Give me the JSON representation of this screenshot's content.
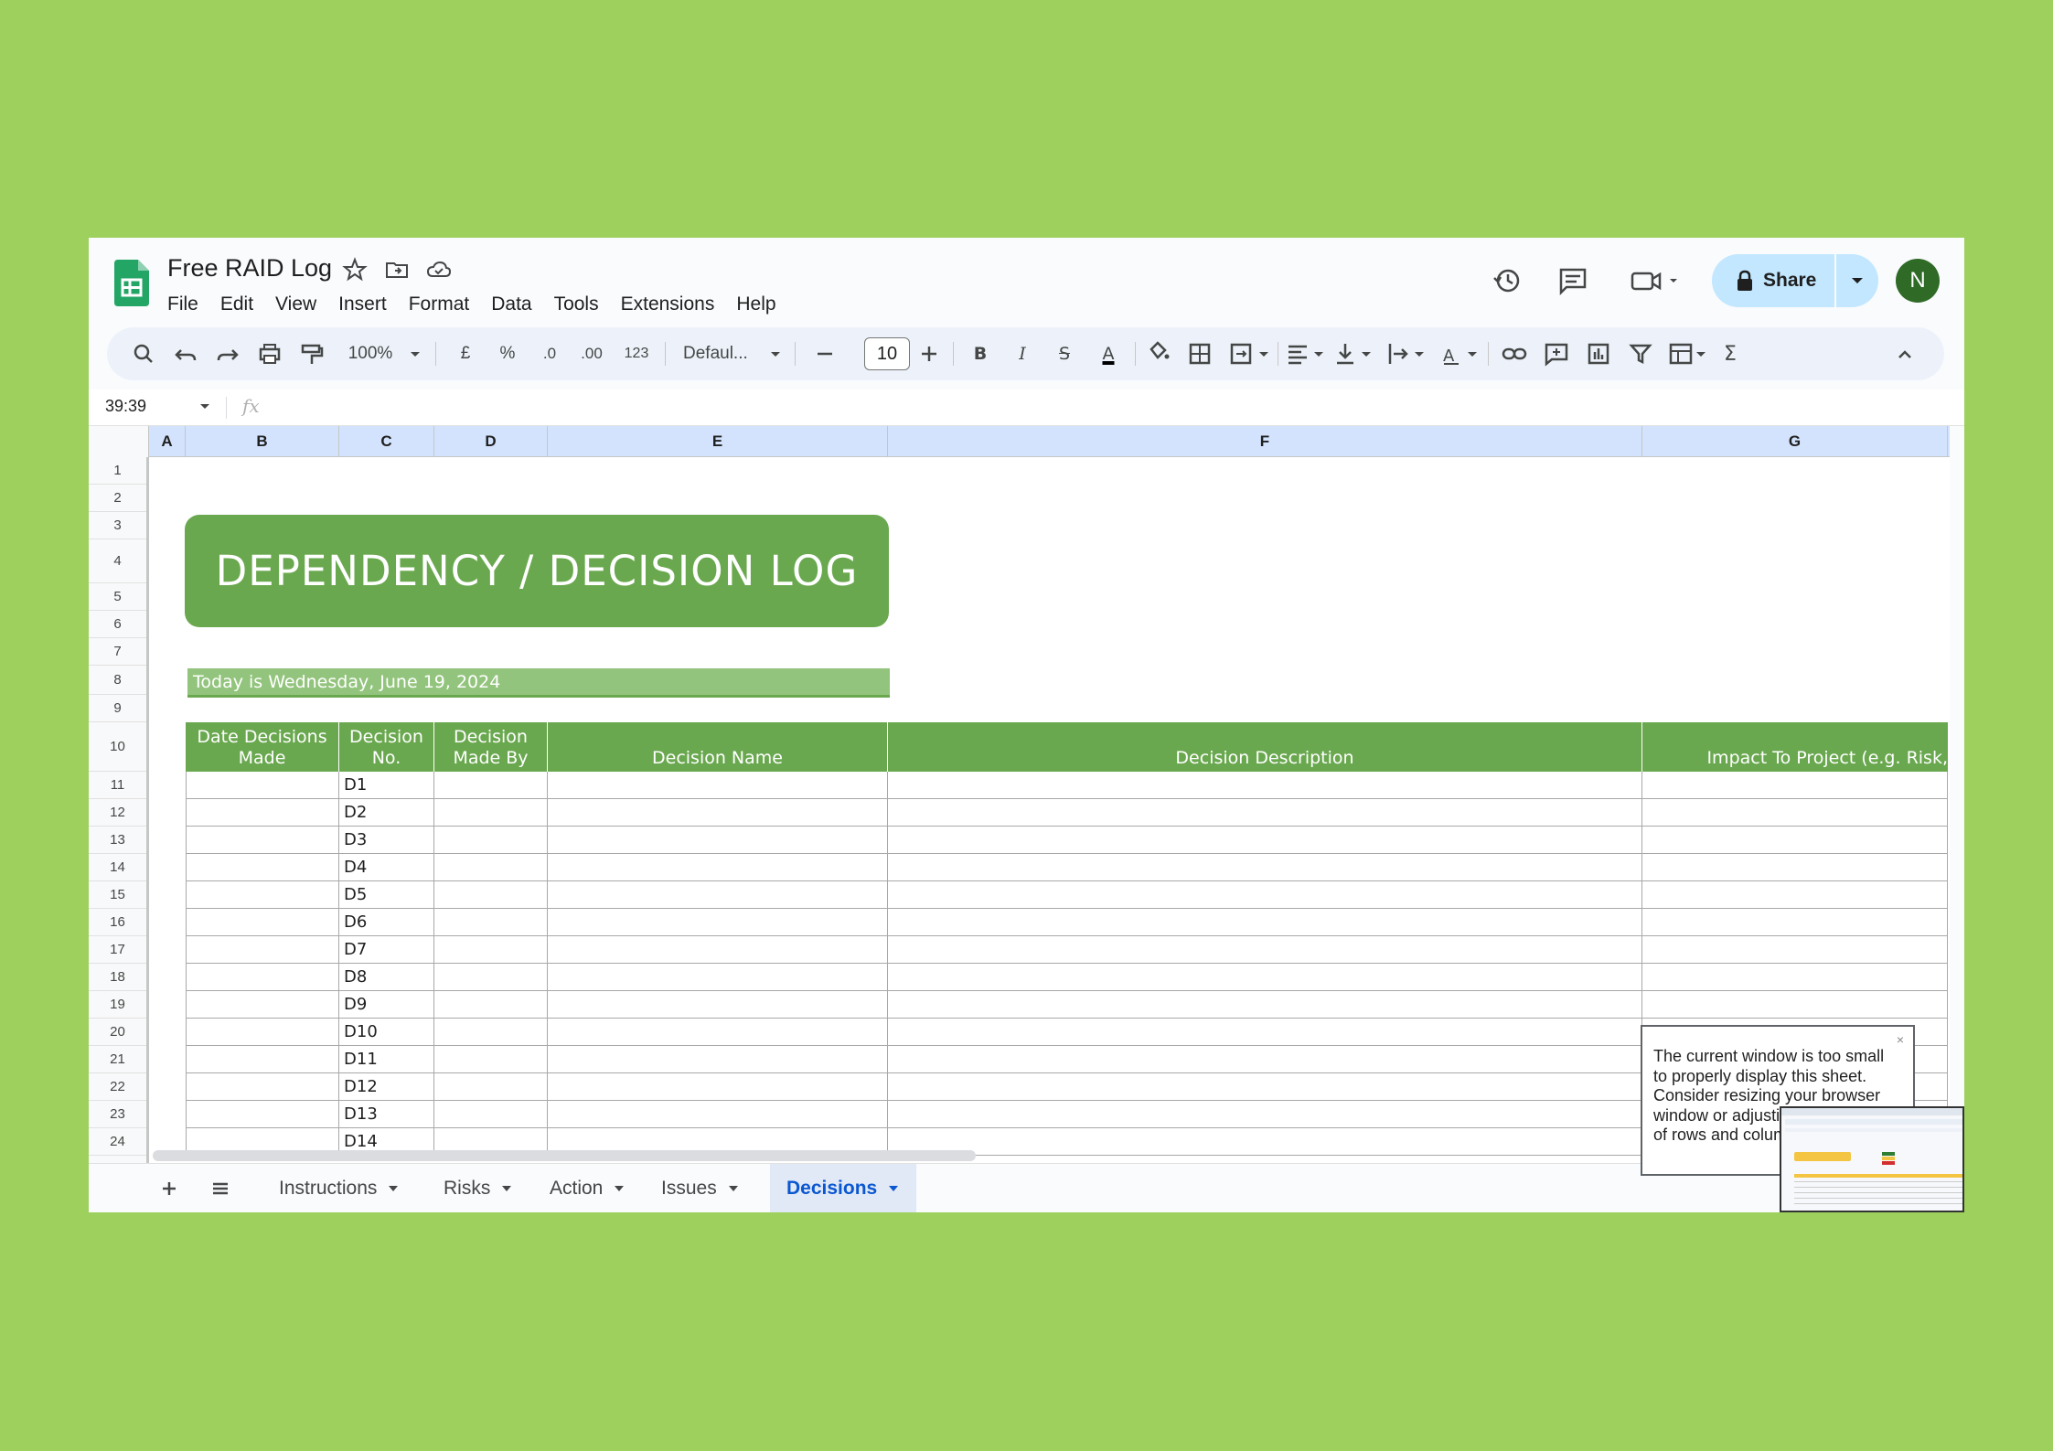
{
  "app": {
    "title": "Free RAID Log"
  },
  "menu": [
    "File",
    "Edit",
    "View",
    "Insert",
    "Format",
    "Data",
    "Tools",
    "Extensions",
    "Help"
  ],
  "share": {
    "label": "Share",
    "avatar": "N"
  },
  "toolbar": {
    "zoom": "100%",
    "currency": "£",
    "percent": "%",
    "decrease_decimal": ".0",
    "increase_decimal": ".00",
    "number_format": "123",
    "font": "Defaul...",
    "font_size": "10",
    "bold": "B",
    "italic": "I",
    "strike": "S",
    "text_color": "A"
  },
  "formula_bar": {
    "cell_ref": "39:39",
    "fx": "fx"
  },
  "columns": [
    "A",
    "B",
    "C",
    "D",
    "E",
    "F",
    "G"
  ],
  "rows": [
    "1",
    "2",
    "3",
    "4",
    "5",
    "6",
    "7",
    "8",
    "9",
    "10",
    "11",
    "12",
    "13",
    "14",
    "15",
    "16",
    "17",
    "18",
    "19",
    "20",
    "21",
    "22",
    "23",
    "24"
  ],
  "sheet": {
    "banner": "DEPENDENCY / DECISION LOG",
    "today": "Today is Wednesday, June 19, 2024",
    "headers": [
      "Date Decisions\nMade",
      "Decision\nNo.",
      "Decision\nMade By",
      "Decision Name",
      "Decision Description",
      "Impact To Project (e.g. Risk,"
    ],
    "decision_numbers": [
      "D1",
      "D2",
      "D3",
      "D4",
      "D5",
      "D6",
      "D7",
      "D8",
      "D9",
      "D10",
      "D11",
      "D12",
      "D13",
      "D14"
    ]
  },
  "tabs": [
    {
      "label": "Instructions",
      "active": false
    },
    {
      "label": "Risks",
      "active": false
    },
    {
      "label": "Action",
      "active": false
    },
    {
      "label": "Issues",
      "active": false
    },
    {
      "label": "Decisions",
      "active": true
    }
  ],
  "popup": {
    "text": "The current window is too small to properly display this sheet. Consider resizing your browser window or adjusting the number of rows and columns",
    "close": "×"
  },
  "colors": {
    "background": "#9ed05d",
    "header_green": "#6aa84f",
    "today_green": "#93c47d",
    "share_blue": "#c2e7ff",
    "active_tab": "#0b57d0"
  }
}
